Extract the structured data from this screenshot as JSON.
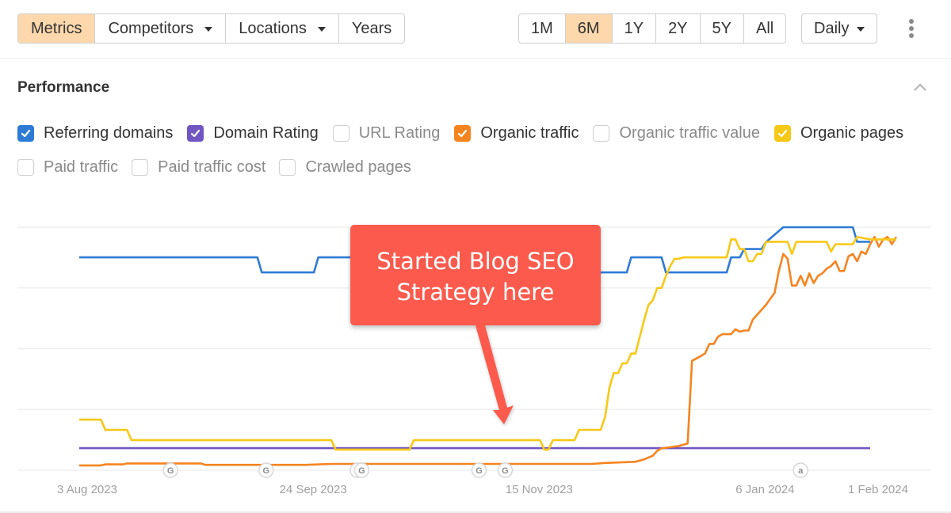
{
  "toolbar": {
    "left_tabs": [
      {
        "label": "Metrics",
        "active": true,
        "dropdown": false
      },
      {
        "label": "Competitors",
        "active": false,
        "dropdown": true
      },
      {
        "label": "Locations",
        "active": false,
        "dropdown": true
      },
      {
        "label": "Years",
        "active": false,
        "dropdown": false
      }
    ],
    "ranges": [
      {
        "label": "1M",
        "active": false
      },
      {
        "label": "6M",
        "active": true
      },
      {
        "label": "1Y",
        "active": false
      },
      {
        "label": "2Y",
        "active": false
      },
      {
        "label": "5Y",
        "active": false
      },
      {
        "label": "All",
        "active": false
      }
    ],
    "interval": {
      "label": "Daily",
      "dropdown": true
    },
    "more_icon": "vertical-ellipsis-icon"
  },
  "section": {
    "title": "Performance",
    "collapse_icon": "chevron-up-icon"
  },
  "legend": {
    "row1": [
      {
        "label": "Referring domains",
        "checked": true,
        "color": "#2e7bd6"
      },
      {
        "label": "Domain Rating",
        "checked": true,
        "color": "#6f56c1"
      },
      {
        "label": "URL Rating",
        "checked": false,
        "color": "#d0d0d0"
      },
      {
        "label": "Organic traffic",
        "checked": true,
        "color": "#f5841f"
      },
      {
        "label": "Organic traffic value",
        "checked": false,
        "color": "#d0d0d0"
      },
      {
        "label": "Organic pages",
        "checked": true,
        "color": "#f7c815"
      }
    ],
    "row2": [
      {
        "label": "Paid traffic",
        "checked": false,
        "color": "#d0d0d0"
      },
      {
        "label": "Paid traffic cost",
        "checked": false,
        "color": "#d0d0d0"
      },
      {
        "label": "Crawled pages",
        "checked": false,
        "color": "#d0d0d0"
      }
    ]
  },
  "annotation": {
    "line1": "Started Blog SEO",
    "line2": "Strategy here",
    "color": "#fb5a4d",
    "points_to_day": 97
  },
  "chart_data": {
    "type": "line",
    "title": "Performance",
    "xlabel": "",
    "ylabel": "",
    "x_unit": "days since 3 Aug 2023",
    "y_unit": "normalized per-series (0-100)",
    "xlim": [
      -14,
      196
    ],
    "ylim": [
      0,
      100
    ],
    "grid": true,
    "gridlines_y": [
      0,
      25,
      50,
      75,
      100
    ],
    "x_ticks": [
      {
        "day": 0,
        "label": "3 Aug 2023"
      },
      {
        "day": 52,
        "label": "24 Sep 2023"
      },
      {
        "day": 104,
        "label": "15 Nov 2023"
      },
      {
        "day": 156,
        "label": "6 Jan 2024"
      },
      {
        "day": 182,
        "label": "1 Feb 2024"
      }
    ],
    "event_markers": [
      {
        "day": 21,
        "label": "G"
      },
      {
        "day": 43,
        "label": "G"
      },
      {
        "day": 64,
        "label": "G"
      },
      {
        "day": 65,
        "label": "G"
      },
      {
        "day": 92,
        "label": "G"
      },
      {
        "day": 98,
        "label": "G"
      },
      {
        "day": 166,
        "label": "a"
      }
    ],
    "series": [
      {
        "name": "Referring domains",
        "color": "#2e7bd6",
        "points": [
          [
            0,
            87.6
          ],
          [
            41,
            87.6
          ],
          [
            42,
            81.4
          ],
          [
            54,
            81.4
          ],
          [
            55,
            87.6
          ],
          [
            117,
            87.6
          ],
          [
            118,
            81.4
          ],
          [
            126,
            81.4
          ],
          [
            127,
            87.6
          ],
          [
            134,
            87.6
          ],
          [
            135,
            81.4
          ],
          [
            149,
            81.4
          ],
          [
            150,
            87.6
          ],
          [
            152,
            87.6
          ],
          [
            153,
            91
          ],
          [
            157,
            91
          ],
          [
            158,
            93.8
          ],
          [
            162,
            100
          ],
          [
            178,
            100
          ],
          [
            179,
            94
          ],
          [
            182,
            94
          ]
        ]
      },
      {
        "name": "Domain Rating",
        "color": "#6f56c1",
        "points": [
          [
            0,
            9.1
          ],
          [
            182,
            9.1
          ]
        ]
      },
      {
        "name": "Organic traffic",
        "color": "#f5841f",
        "points": [
          [
            0,
            2
          ],
          [
            5,
            2
          ],
          [
            6,
            2.4
          ],
          [
            10,
            2.4
          ],
          [
            11,
            2.8
          ],
          [
            28,
            2.8
          ],
          [
            29,
            2.2
          ],
          [
            52,
            2.2
          ],
          [
            58,
            2.6
          ],
          [
            100,
            2.6
          ],
          [
            118,
            2.6
          ],
          [
            121,
            3
          ],
          [
            128,
            3.5
          ],
          [
            130,
            4.5
          ],
          [
            132,
            6
          ],
          [
            133,
            8
          ],
          [
            134,
            9
          ],
          [
            138,
            10
          ],
          [
            140,
            11
          ],
          [
            141,
            45
          ],
          [
            142,
            46
          ],
          [
            143,
            47
          ],
          [
            144,
            48
          ],
          [
            145,
            52
          ],
          [
            146,
            52
          ],
          [
            147,
            55
          ],
          [
            148,
            56
          ],
          [
            150,
            56
          ],
          [
            151,
            58
          ],
          [
            152,
            57
          ],
          [
            153,
            57.5
          ],
          [
            154,
            57.5
          ],
          [
            155,
            62
          ],
          [
            157,
            66
          ],
          [
            158,
            68
          ],
          [
            160,
            73
          ],
          [
            161,
            82
          ],
          [
            162,
            89
          ],
          [
            163,
            87
          ],
          [
            164,
            76
          ],
          [
            165,
            76
          ],
          [
            166,
            80
          ],
          [
            167,
            76
          ],
          [
            168,
            81
          ],
          [
            169,
            77
          ],
          [
            170,
            80
          ],
          [
            171,
            81
          ],
          [
            172,
            83
          ],
          [
            173,
            84
          ],
          [
            174,
            86
          ],
          [
            175,
            82
          ],
          [
            176,
            82
          ],
          [
            177,
            88
          ],
          [
            178,
            89
          ],
          [
            179,
            86
          ],
          [
            180,
            90
          ],
          [
            181,
            89
          ],
          [
            182,
            93
          ],
          [
            183,
            96
          ],
          [
            184,
            92
          ],
          [
            185,
            95
          ],
          [
            186,
            96
          ],
          [
            187,
            93
          ],
          [
            188,
            96
          ]
        ]
      },
      {
        "name": "Organic pages",
        "color": "#f7c815",
        "points": [
          [
            0,
            20.8
          ],
          [
            5,
            20.8
          ],
          [
            6,
            16.6
          ],
          [
            11,
            16.6
          ],
          [
            12,
            12.4
          ],
          [
            58,
            12.4
          ],
          [
            59,
            8.5
          ],
          [
            76,
            8.5
          ],
          [
            77,
            12.4
          ],
          [
            106,
            12.4
          ],
          [
            107,
            8.5
          ],
          [
            108,
            8.5
          ],
          [
            109,
            12.4
          ],
          [
            114,
            12.4
          ],
          [
            115,
            16.6
          ],
          [
            120,
            16.6
          ],
          [
            121,
            22
          ],
          [
            122,
            34
          ],
          [
            123,
            40
          ],
          [
            124,
            40
          ],
          [
            125,
            44
          ],
          [
            126,
            44
          ],
          [
            127,
            48
          ],
          [
            128,
            48
          ],
          [
            129,
            55
          ],
          [
            130,
            62
          ],
          [
            131,
            68
          ],
          [
            132,
            70
          ],
          [
            133,
            75
          ],
          [
            134,
            75
          ],
          [
            135,
            80
          ],
          [
            136,
            84
          ],
          [
            137,
            87
          ],
          [
            138,
            87
          ],
          [
            139,
            87.6
          ],
          [
            140,
            87.6
          ],
          [
            141,
            87.6
          ],
          [
            149,
            87.6
          ],
          [
            150,
            95
          ],
          [
            151,
            95
          ],
          [
            152,
            91
          ],
          [
            153,
            91
          ],
          [
            154,
            86
          ],
          [
            155,
            86
          ],
          [
            156,
            89
          ],
          [
            157,
            89
          ],
          [
            158,
            94
          ],
          [
            163,
            94
          ],
          [
            164,
            89
          ],
          [
            165,
            94
          ],
          [
            172,
            94
          ],
          [
            173,
            90
          ],
          [
            174,
            93
          ],
          [
            178,
            93
          ],
          [
            179,
            96
          ],
          [
            182,
            95
          ],
          [
            188,
            95
          ]
        ]
      }
    ]
  }
}
